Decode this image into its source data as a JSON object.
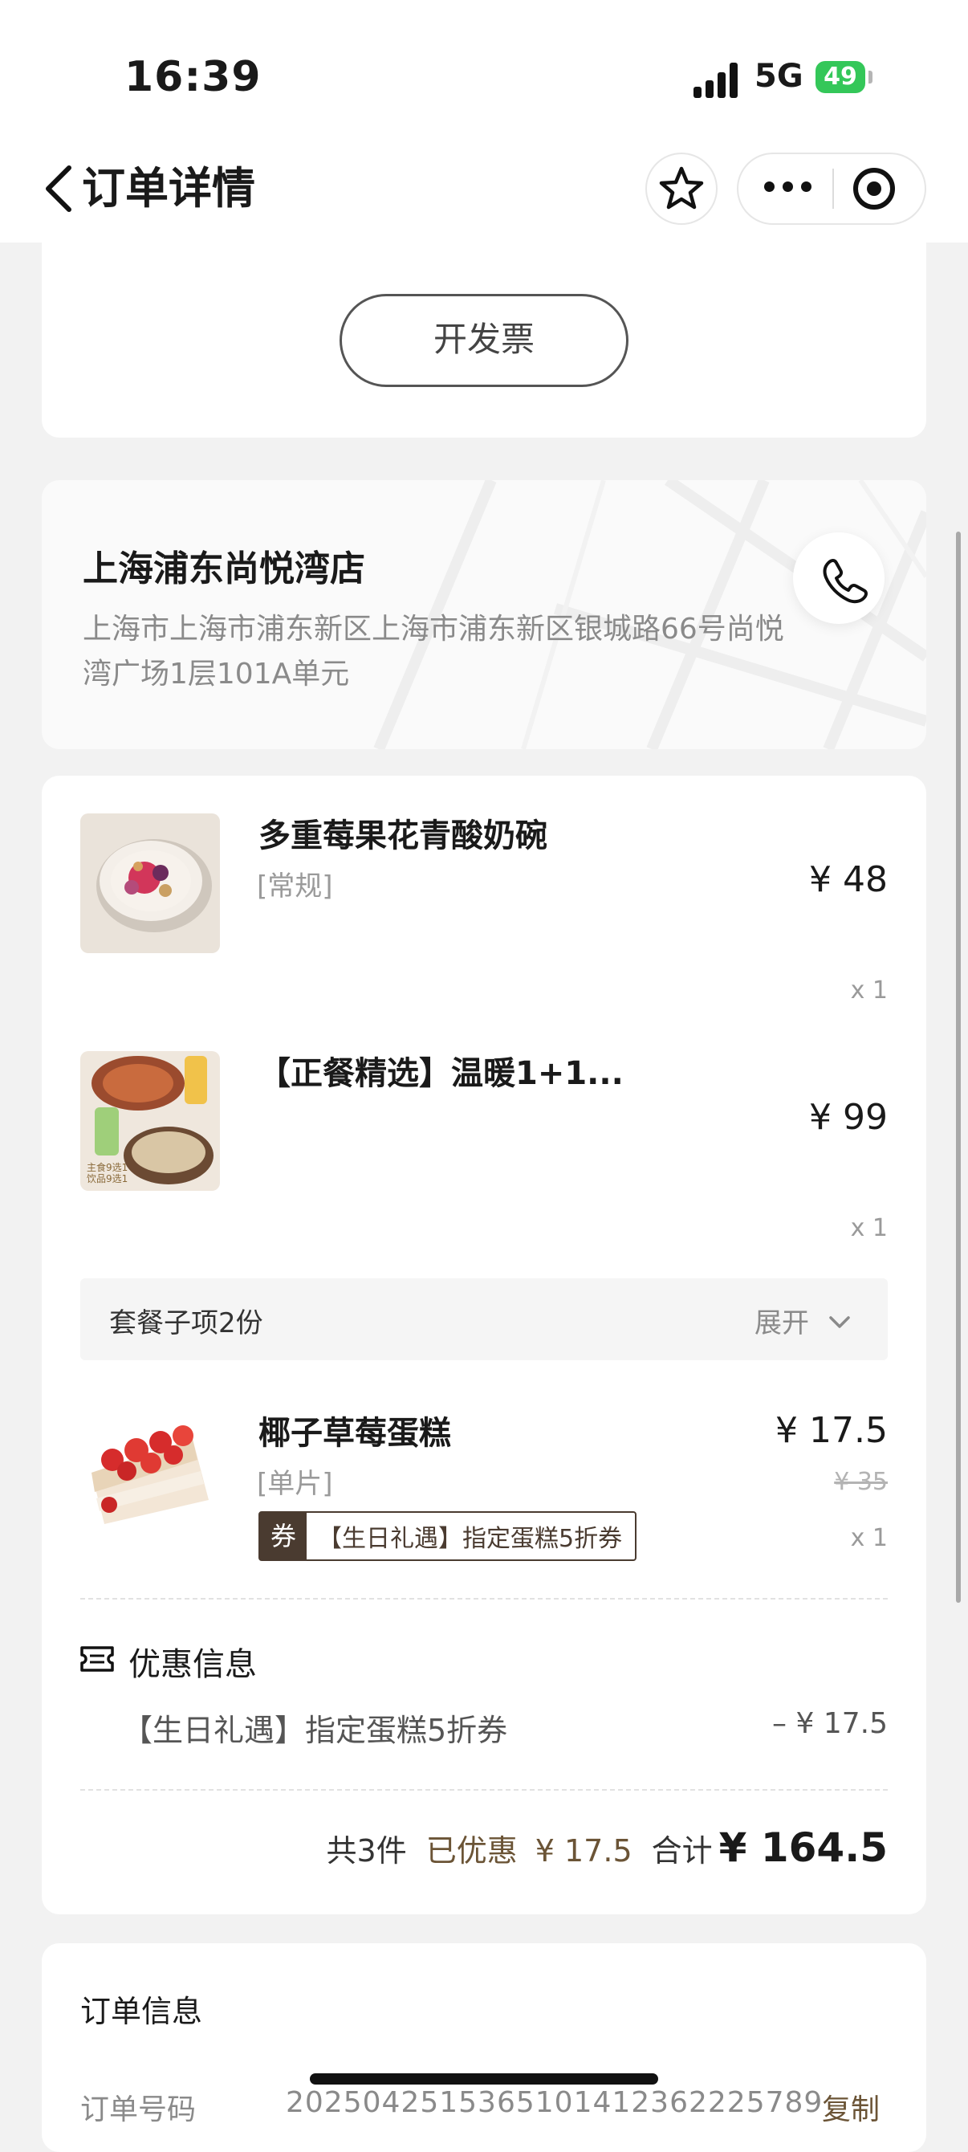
{
  "status_bar": {
    "time": "16:39",
    "network": "5G",
    "battery": "49"
  },
  "nav": {
    "title": "订单详情",
    "icons": [
      "back-icon",
      "star-icon",
      "more-icon",
      "target-icon"
    ]
  },
  "invoice": {
    "button_label": "开发票"
  },
  "store": {
    "name": "上海浦东尚悦湾店",
    "address": "上海市上海市浦东新区上海市浦东新区银城路66号尚悦湾广场1层101A单元",
    "icon": "phone-icon"
  },
  "items": [
    {
      "name": "多重莓果花青酸奶碗",
      "spec": "[常规]",
      "price": "¥ 48",
      "qty": "x 1"
    },
    {
      "name": "【正餐精选】温暖1+1...",
      "spec": "",
      "price": "¥ 99",
      "qty": "x 1",
      "thumb_text": [
        "主食9选1",
        "饮品9选1"
      ]
    },
    {
      "name": "椰子草莓蛋糕",
      "spec": "[单片]",
      "price": "¥ 17.5",
      "original_price": "¥ 35",
      "qty": "x 1",
      "coupon_badge": "券",
      "coupon_name": "【生日礼遇】指定蛋糕5折券"
    }
  ],
  "package": {
    "label": "套餐子项2份",
    "toggle": "展开"
  },
  "discount": {
    "title": "优惠信息",
    "line": "【生日礼遇】指定蛋糕5折券",
    "amount": "– ¥ 17.5"
  },
  "summary": {
    "count": "共3件",
    "saved_label": "已优惠",
    "saved_amount": "¥ 17.5",
    "total_label": "合计",
    "total": "¥ 164.5"
  },
  "order_info": {
    "title": "订单信息",
    "order_no_label": "订单号码",
    "order_no": "2025042515365101412362225789",
    "copy": "复制"
  },
  "colors": {
    "accent": "#6b5436",
    "coupon": "#4a3b30",
    "battery": "#34c759"
  }
}
